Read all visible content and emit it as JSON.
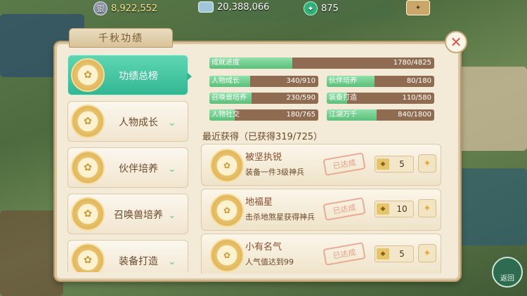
{
  "resources": {
    "silver": {
      "icon": "silver-coin-icon",
      "value": "8,922,552"
    },
    "coins": {
      "icon": "coin-pile-icon",
      "value": "20,388,066"
    },
    "jade": {
      "icon": "jade-icon",
      "value": "875"
    }
  },
  "panel": {
    "title": "千秋功绩",
    "close_icon": "✕"
  },
  "sidebar": {
    "items": [
      {
        "label": "功绩总榜",
        "active": true
      },
      {
        "label": "人物成长",
        "active": false
      },
      {
        "label": "伙伴培养",
        "active": false
      },
      {
        "label": "召唤兽培养",
        "active": false
      },
      {
        "label": "装备打造",
        "active": false
      }
    ]
  },
  "stats": {
    "overall": {
      "name": "成就进度",
      "current": 1780,
      "total": 4825,
      "text": "1780/4825"
    },
    "categories": [
      {
        "name": "人物成长",
        "current": 340,
        "total": 910,
        "text": "340/910"
      },
      {
        "name": "伙伴培养",
        "current": 80,
        "total": 180,
        "text": "80/180"
      },
      {
        "name": "召唤兽培养",
        "current": 230,
        "total": 590,
        "text": "230/590"
      },
      {
        "name": "装备打造",
        "current": 110,
        "total": 580,
        "text": "110/580"
      },
      {
        "name": "人物社交",
        "current": 180,
        "total": 765,
        "text": "180/765"
      },
      {
        "name": "江湖万千",
        "current": 840,
        "total": 1800,
        "text": "840/1800"
      }
    ]
  },
  "recent": {
    "title": "最近获得（已获得319/725）",
    "items": [
      {
        "name": "被坚执锐",
        "desc": "装备一件3级神兵",
        "stamp": "已达成",
        "points": "5"
      },
      {
        "name": "地福星",
        "desc": "击杀地煞星获得神兵",
        "stamp": "已达成",
        "points": "10"
      },
      {
        "name": "小有名气",
        "desc": "人气值达到99",
        "stamp": "已达成",
        "points": "5"
      }
    ]
  },
  "back_button": {
    "label": "返回"
  }
}
